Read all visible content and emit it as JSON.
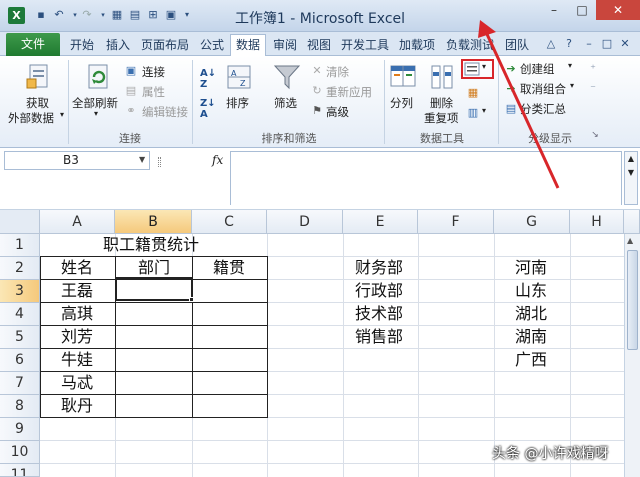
{
  "window": {
    "title": "工作簿1 - Microsoft Excel",
    "logo_letter": "X",
    "buttons": {
      "minimize": "–",
      "maximize": "□",
      "close": "✕"
    }
  },
  "quick_access": {
    "save_glyph": "▪",
    "undo_glyph": "↶",
    "redo_glyph": "↷"
  },
  "tabs": {
    "file": "文件",
    "items": [
      "开始",
      "插入",
      "页面布局",
      "公式",
      "数据",
      "审阅",
      "视图",
      "开发工具",
      "加载项",
      "负载测试",
      "团队"
    ],
    "active": "数据"
  },
  "ribbon": {
    "get_external_data": {
      "line1": "获取",
      "line2": "外部数据"
    },
    "refresh_all": "全部刷新",
    "connections": "连接",
    "properties": "属性",
    "edit_links": "编辑链接",
    "group_connections": "连接",
    "sort_asc_glyph": "A↓Z",
    "sort": "排序",
    "filter": "筛选",
    "clear": "清除",
    "reapply": "重新应用",
    "advanced": "高级",
    "group_sort_filter": "排序和筛选",
    "text_to_columns": "分列",
    "remove_duplicates": {
      "line1": "删除",
      "line2": "重复项"
    },
    "group_data_tools": "数据工具",
    "group": "创建组",
    "ungroup": "取消组合",
    "subtotal": "分类汇总",
    "group_outline": "分级显示"
  },
  "formula_bar": {
    "name_box": "B3",
    "fx": "fx",
    "formula": ""
  },
  "grid": {
    "columns": [
      "A",
      "B",
      "C",
      "D",
      "E",
      "F",
      "G",
      "H"
    ],
    "rows": [
      "1",
      "2",
      "3",
      "4",
      "5",
      "6",
      "7",
      "8",
      "9",
      "10",
      "11"
    ],
    "selected_column": "B",
    "selected_row": "3",
    "table_title": "职工籍贯统计",
    "headers": {
      "name": "姓名",
      "dept": "部门",
      "origin": "籍贯"
    },
    "names": [
      "王磊",
      "高琪",
      "刘芳",
      "牛娃",
      "马忒",
      "耿丹"
    ],
    "departments": [
      "财务部",
      "行政部",
      "技术部",
      "销售部"
    ],
    "provinces": [
      "河南",
      "山东",
      "湖北",
      "湖南",
      "广西"
    ]
  },
  "watermark": "头条 @小许戏精呀",
  "colors": {
    "annotation_red": "#d8262a",
    "file_tab_green": "#2a8a3a",
    "selection_orange": "#f5c97c"
  }
}
